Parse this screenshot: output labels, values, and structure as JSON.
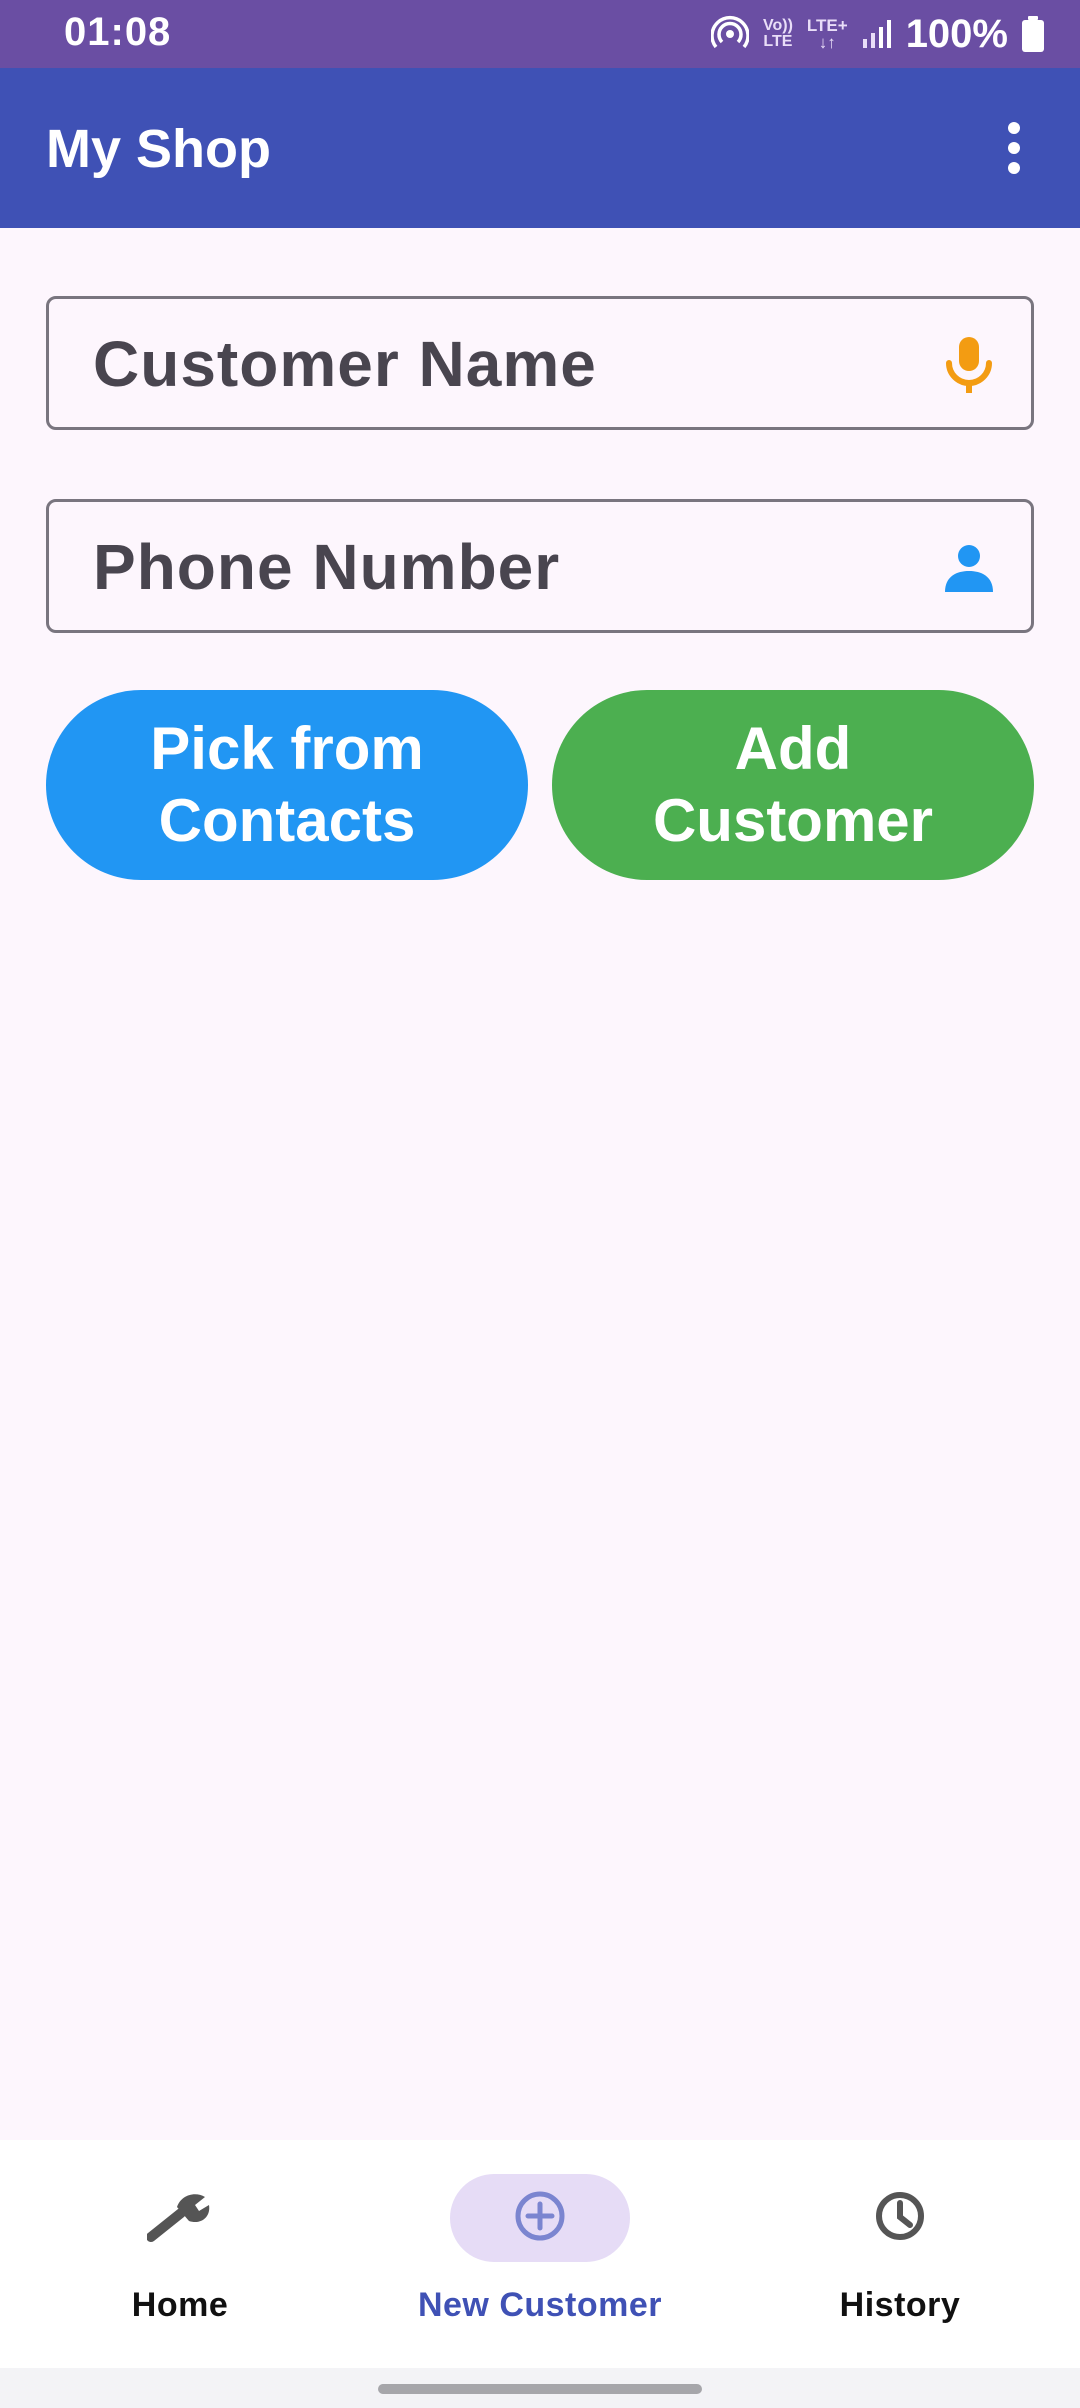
{
  "status_bar": {
    "time": "01:08",
    "volte_top": "Vo))",
    "volte_bottom": "LTE",
    "lte_top": "LTE+",
    "lte_bottom": "↓↑",
    "battery": "100%",
    "icons": [
      "hotspot-icon",
      "signal-icon",
      "battery-icon"
    ]
  },
  "app_bar": {
    "title": "My Shop",
    "menu_icon": "more-vert-icon"
  },
  "form": {
    "customer_name": {
      "placeholder": "Customer Name",
      "value": "",
      "icon": "mic-icon",
      "icon_color": "#F39C12"
    },
    "phone_number": {
      "placeholder": "Phone Number",
      "value": "",
      "icon": "person-icon",
      "icon_color": "#2196F3"
    }
  },
  "buttons": {
    "pick_contacts": {
      "line1": "Pick from",
      "line2": "Contacts",
      "color": "#2196F3"
    },
    "add_customer": {
      "line1": "Add",
      "line2": "Customer",
      "color": "#4CAF50"
    }
  },
  "bottom_nav": {
    "items": [
      {
        "label": "Home",
        "icon": "wrench-icon",
        "selected": false
      },
      {
        "label": "New Customer",
        "icon": "add-circle-icon",
        "selected": true
      },
      {
        "label": "History",
        "icon": "clock-icon",
        "selected": false
      }
    ],
    "accent_color": "#3F51B5"
  },
  "colors": {
    "status_bar": "#6A4EA3",
    "app_bar": "#3F51B5",
    "background": "#FDF6FD"
  }
}
